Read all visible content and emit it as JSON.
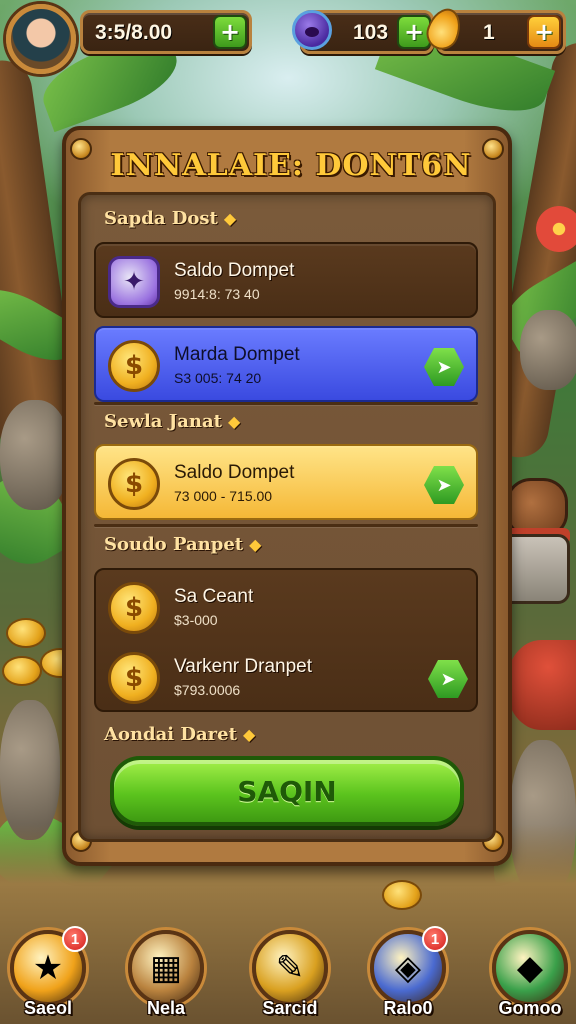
{
  "header": {
    "coins_value": "3:5/8.00",
    "gems_value": "103",
    "energy_value": "1",
    "plus_symbol": "+"
  },
  "panel": {
    "title": "INNALAIE: DONT6N",
    "sections": [
      {
        "label": "Sapda Dost",
        "rows": [
          {
            "title": "Saldo Dompet",
            "subtitle": "9914:8: 73 40",
            "icon": "gem-bundle-icon",
            "style": "dark",
            "has_go": false
          }
        ]
      },
      {
        "label": "",
        "rows": [
          {
            "title": "Marda Dompet",
            "subtitle": "S3 005: 74 20",
            "icon": "coin-icon",
            "style": "blue",
            "has_go": true
          }
        ]
      },
      {
        "label": "Sewla Janat",
        "rows": [
          {
            "title": "Saldo Dompet",
            "subtitle": "73 000 - 715.00",
            "icon": "coin-icon",
            "style": "gold",
            "has_go": true
          }
        ]
      },
      {
        "label": "Soudo Panpet",
        "rows": [
          {
            "title": "Sa Ceant",
            "subtitle": "$3-000",
            "icon": "coin-icon",
            "style": "dark",
            "has_go": false
          },
          {
            "title": "Varkenr Dranpet",
            "subtitle": "$793.0006",
            "icon": "coin-icon",
            "style": "dark",
            "has_go": true
          }
        ]
      },
      {
        "label": "Aondai Daret",
        "rows": []
      }
    ],
    "coin_symbol": "$",
    "star_symbol": "◆",
    "cta_label": "SAQIN"
  },
  "nav": [
    {
      "label": "Saeol",
      "icon": "star-icon",
      "glyph": "★",
      "badge": "1",
      "color": "#f0a21a"
    },
    {
      "label": "Nela",
      "icon": "map-icon",
      "glyph": "▦",
      "badge": "",
      "color": "#b9823e"
    },
    {
      "label": "Sarcid",
      "icon": "scroll-icon",
      "glyph": "✎",
      "badge": "",
      "color": "#d9a020"
    },
    {
      "label": "Ralo0",
      "icon": "dice-icon",
      "glyph": "◈",
      "badge": "1",
      "color": "#4a6ad0"
    },
    {
      "label": "Gomoo",
      "icon": "crystal-icon",
      "glyph": "◆",
      "badge": "",
      "color": "#3aa04a"
    }
  ],
  "colors": {
    "accent_gold": "#ffc93a",
    "button_green": "#5cc41e",
    "highlight_blue": "#3a4ae0",
    "badge_red": "#d21a1a"
  }
}
